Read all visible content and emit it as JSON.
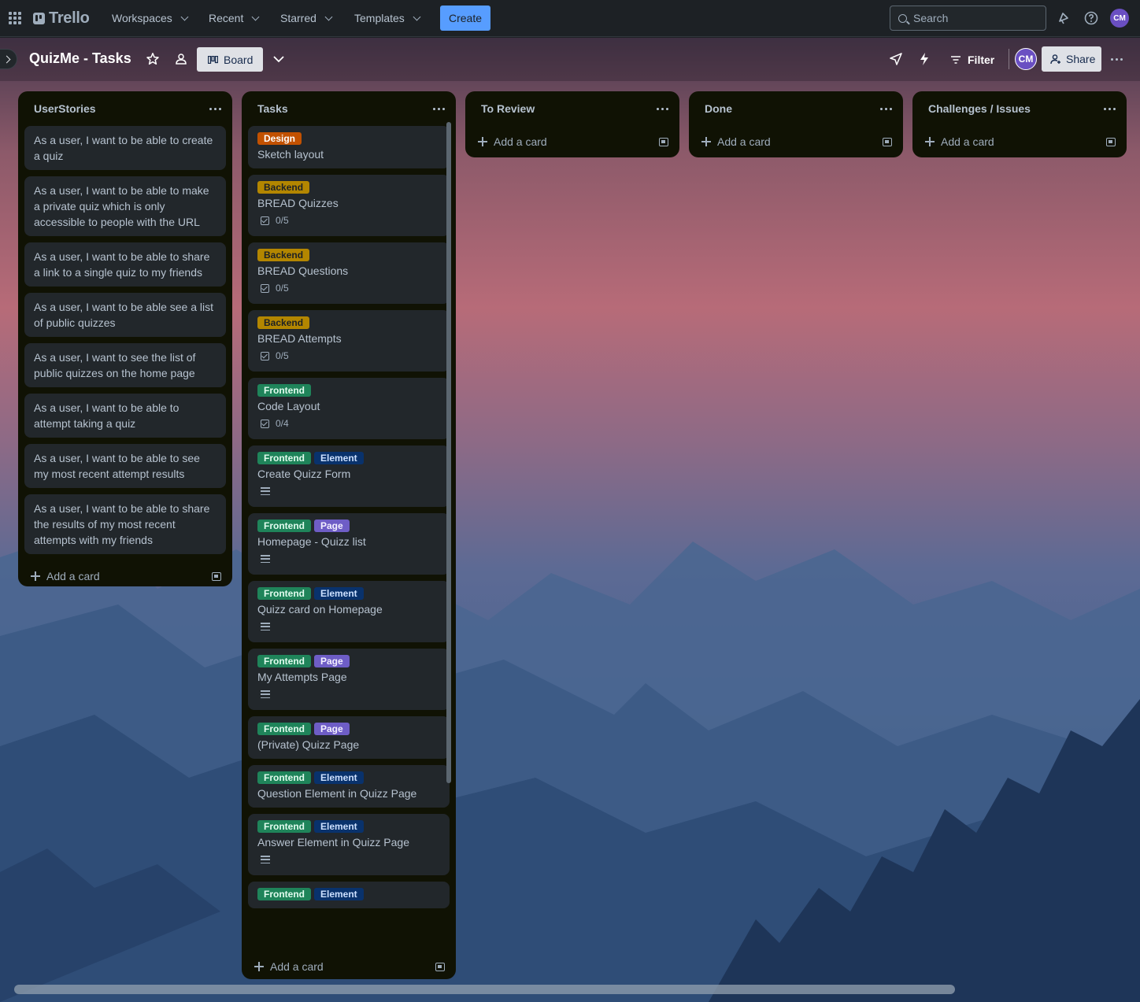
{
  "topnav": {
    "logo": "Trello",
    "menus": [
      "Workspaces",
      "Recent",
      "Starred",
      "Templates"
    ],
    "create_label": "Create",
    "search_placeholder": "Search",
    "avatar_initials": "CM"
  },
  "board": {
    "title": "QuizMe - Tasks",
    "view_label": "Board",
    "filter_label": "Filter",
    "share_label": "Share",
    "member_initials": "CM"
  },
  "colors": {
    "accent": "#579dff",
    "avatar": "#6a4fc2",
    "list_bg": "#101204",
    "card_bg": "#22272b"
  },
  "lists": [
    {
      "title": "UserStories",
      "cards": [
        {
          "title": "As a user, I want to be able to create a quiz"
        },
        {
          "title": "As a user, I want to be able to make a private quiz which is only accessible to people with the URL"
        },
        {
          "title": "As a user, I want to be able to share a link to a single quiz to my friends"
        },
        {
          "title": "As a user, I want to be able see a list of public quizzes"
        },
        {
          "title": "As a user, I want to see the list of public quizzes on the home page"
        },
        {
          "title": "As a user, I want to be able to attempt taking a quiz"
        },
        {
          "title": "As a user, I want to be able to see my most recent attempt results"
        },
        {
          "title": "As a user, I want to be able to share the results of my most recent attempts with my friends"
        }
      ],
      "add_label": "Add a card"
    },
    {
      "title": "Tasks",
      "cards": [
        {
          "labels": [
            "Design"
          ],
          "title": "Sketch layout"
        },
        {
          "labels": [
            "Backend"
          ],
          "title": "BREAD Quizzes",
          "checklist": "0/5"
        },
        {
          "labels": [
            "Backend"
          ],
          "title": "BREAD Questions",
          "checklist": "0/5"
        },
        {
          "labels": [
            "Backend"
          ],
          "title": "BREAD Attempts",
          "checklist": "0/5"
        },
        {
          "labels": [
            "Frontend"
          ],
          "title": "Code Layout",
          "checklist": "0/4"
        },
        {
          "labels": [
            "Frontend",
            "Element"
          ],
          "title": "Create Quizz Form",
          "description": true
        },
        {
          "labels": [
            "Frontend",
            "Page"
          ],
          "title": "Homepage - Quizz list",
          "description": true
        },
        {
          "labels": [
            "Frontend",
            "Element"
          ],
          "title": "Quizz card on Homepage",
          "description": true
        },
        {
          "labels": [
            "Frontend",
            "Page"
          ],
          "title": "My Attempts Page",
          "description": true
        },
        {
          "labels": [
            "Frontend",
            "Page"
          ],
          "title": "(Private) Quizz Page"
        },
        {
          "labels": [
            "Frontend",
            "Element"
          ],
          "title": "Question Element in Quizz Page"
        },
        {
          "labels": [
            "Frontend",
            "Element"
          ],
          "title": "Answer Element in Quizz Page",
          "description": true
        },
        {
          "labels": [
            "Frontend",
            "Element"
          ],
          "title": ""
        }
      ],
      "add_label": "Add a card"
    },
    {
      "title": "To Review",
      "cards": [],
      "add_label": "Add a card"
    },
    {
      "title": "Done",
      "cards": [],
      "add_label": "Add a card"
    },
    {
      "title": "Challenges / Issues",
      "cards": [],
      "add_label": "Add a card"
    }
  ]
}
